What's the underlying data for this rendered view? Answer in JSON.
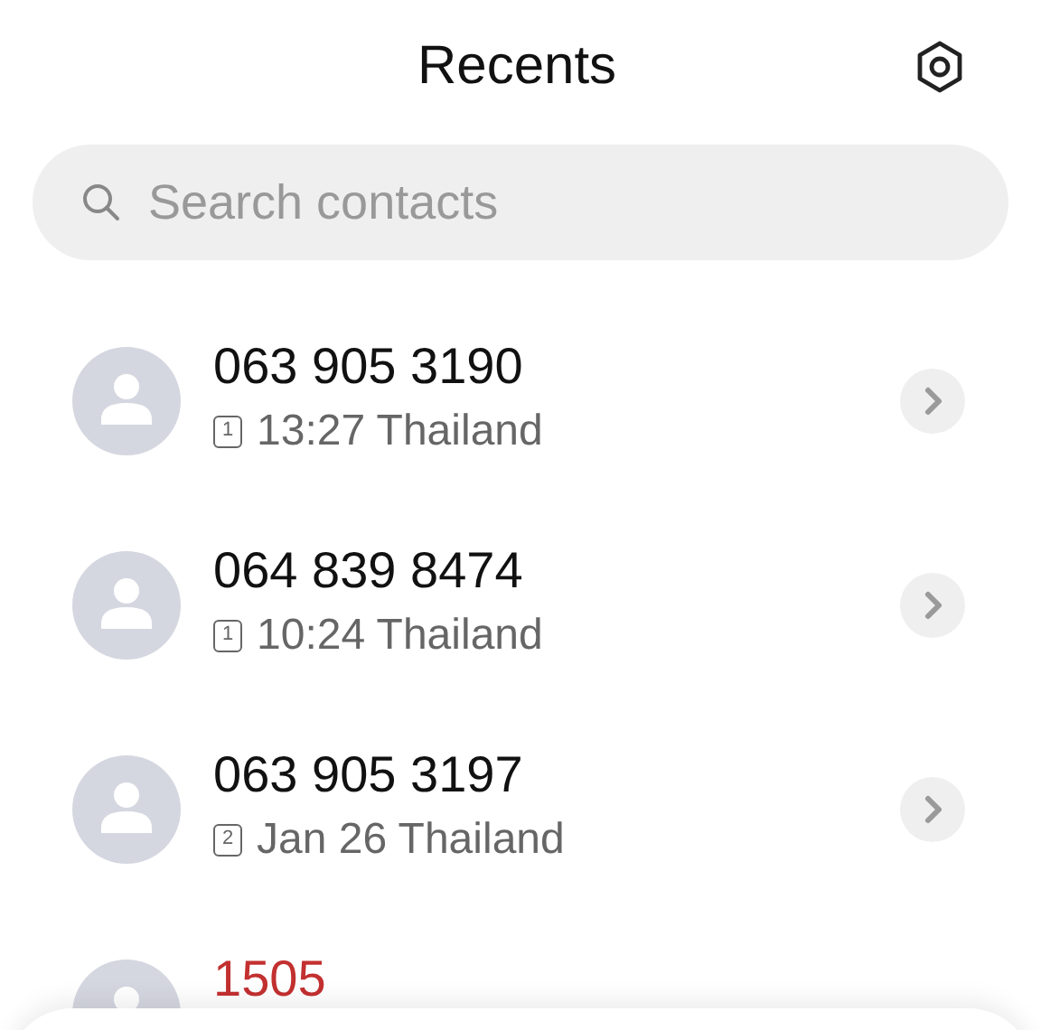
{
  "header": {
    "title": "Recents"
  },
  "search": {
    "placeholder": "Search contacts"
  },
  "calls": [
    {
      "number": "063 905 3190",
      "sim": "1",
      "detail": "13:27 Thailand",
      "missed": false
    },
    {
      "number": "064 839 8474",
      "sim": "1",
      "detail": "10:24 Thailand",
      "missed": false
    },
    {
      "number": "063 905 3197",
      "sim": "2",
      "detail": "Jan 26 Thailand",
      "missed": false
    },
    {
      "number": "1505",
      "missed": true
    }
  ]
}
